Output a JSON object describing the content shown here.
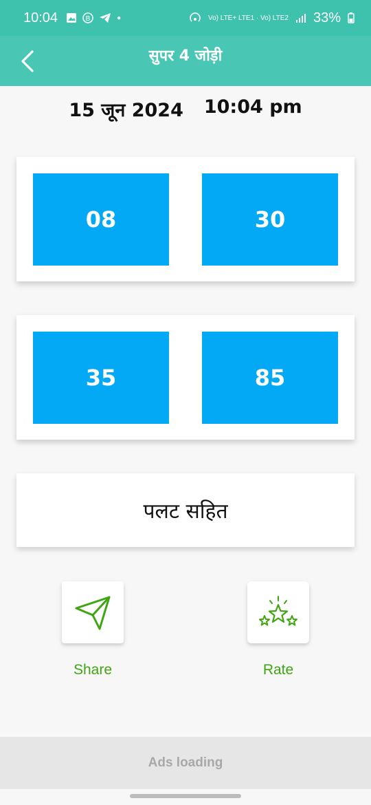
{
  "status_bar": {
    "time": "10:04",
    "network": "Vo) LTE+ LTE1 · Vo) LTE2",
    "battery": "33%"
  },
  "header": {
    "title": "सुपर 4 जोड़ी"
  },
  "datetime": {
    "date": "15 जून 2024",
    "time": "10:04 pm"
  },
  "cards": [
    {
      "numbers": [
        "08",
        "30"
      ]
    },
    {
      "numbers": [
        "35",
        "85"
      ]
    }
  ],
  "palat": {
    "text": "पलट सहित"
  },
  "actions": {
    "share_label": "Share",
    "rate_label": "Rate"
  },
  "ads": {
    "text": "Ads loading"
  },
  "colors": {
    "header_bg": "#4ac7b4",
    "number_box": "#03a9f4",
    "action_green": "#3fa512"
  }
}
